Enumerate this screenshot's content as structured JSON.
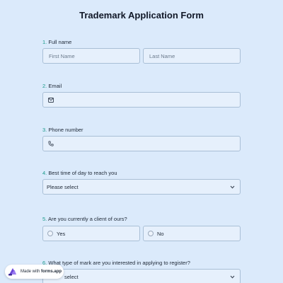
{
  "form": {
    "title": "Trademark Application Form"
  },
  "questions": [
    {
      "number": "1.",
      "label": "Full name",
      "first_placeholder": "First Name",
      "last_placeholder": "Last Name"
    },
    {
      "number": "2.",
      "label": "Email",
      "icon": "envelope-icon"
    },
    {
      "number": "3.",
      "label": "Phone number",
      "icon": "phone-icon"
    },
    {
      "number": "4.",
      "label": "Best time of day to reach you",
      "selected": "Please select"
    },
    {
      "number": "5.",
      "label": "Are you currently a client of ours?",
      "options": [
        "Yes",
        "No"
      ]
    },
    {
      "number": "6.",
      "label": "What type of mark are you interested in applying to register?",
      "selected": "select"
    }
  ],
  "badge": {
    "prefix": "Made with",
    "brand": "forms.app"
  },
  "colors": {
    "background": "#dbeafb",
    "field_bg": "#e6f0fc",
    "field_border": "#a9bfd6",
    "number_accent": "#1a9a8a",
    "brand_logo": "#6c47d9"
  }
}
